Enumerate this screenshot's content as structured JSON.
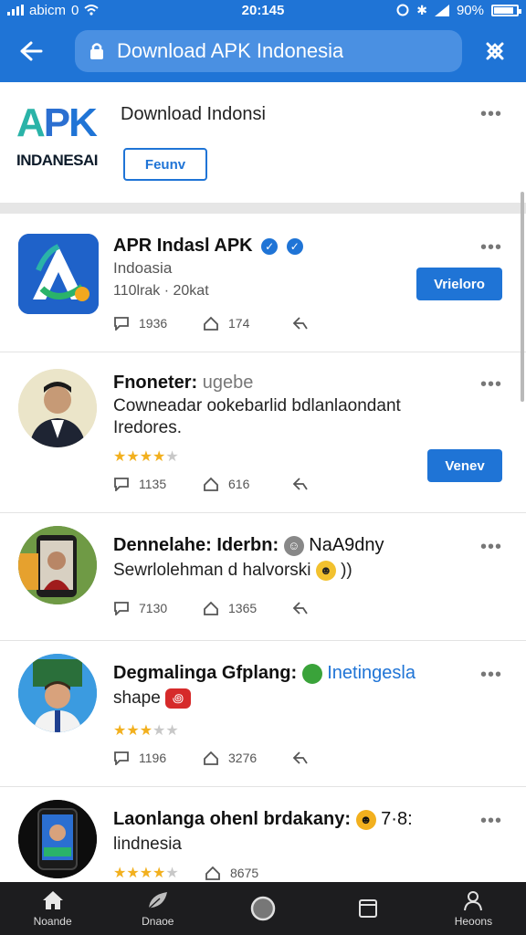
{
  "status_bar": {
    "carrier": "abicm",
    "carrier_extra": "0",
    "time": "20:145",
    "battery": "90%",
    "battery_level": 0.9
  },
  "app_bar": {
    "url": "Download APK Indonesia"
  },
  "header": {
    "logo_text": "APK",
    "logo_subtext": "INDANESAI",
    "title": "Download Indonsi",
    "button": "Feunv"
  },
  "cards": [
    {
      "title": "APR Indasl APK",
      "line1": "Indoasia",
      "line2": "110lrak · 20kat",
      "button": "Vrieloro",
      "comments": "1936",
      "likes": "174"
    },
    {
      "title": "Fnoneter:",
      "title_extra": "ugebe",
      "line1": "Cowneadar ookebarlid bdlanlaondant",
      "line2": "Iredores.",
      "rating": 4,
      "button": "Venev",
      "comments": "1135",
      "likes": "616"
    },
    {
      "title": "Dennelahe: Iderbn:",
      "title_extra": "NaA9dny",
      "line1": "Sewrlolehman d halvorski",
      "line1_extra": "))",
      "comments": "7130",
      "likes": "1365"
    },
    {
      "title": "Degmalinga Gfplang:",
      "title_extra": "Inetingesla",
      "line1": "shape",
      "rating": 3,
      "comments": "1196",
      "likes": "3276"
    },
    {
      "title": "Laonlanga ohenl brdakany:",
      "title_extra": "7·8:",
      "line1": "lindnesia",
      "rating": 4,
      "likes": "8675"
    }
  ],
  "bottom_nav": [
    {
      "label": "Noande",
      "icon": "home-icon"
    },
    {
      "label": "Dnaoe",
      "icon": "leaf-icon"
    },
    {
      "label": "",
      "icon": "circle-icon"
    },
    {
      "label": "",
      "icon": "square-icon"
    },
    {
      "label": "Heoons",
      "icon": "profile-icon"
    }
  ],
  "colors": {
    "primary": "#1f74d6",
    "nav_bg": "#1d1d1f",
    "star": "#f2b01e"
  }
}
